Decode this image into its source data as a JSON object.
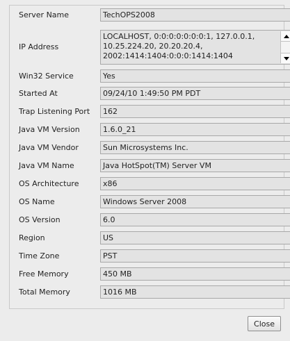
{
  "properties": [
    {
      "label": "Server Name",
      "value": "TechOPS2008"
    },
    {
      "label": "IP Address",
      "value": "LOCALHOST, 0:0:0:0:0:0:0:1, 127.0.0.1, 10.25.224.20, 20.20.20.4, 2002:1414:1404:0:0:0:1414:1404"
    },
    {
      "label": "Win32 Service",
      "value": "Yes"
    },
    {
      "label": "Started At",
      "value": "09/24/10 1:49:50 PM PDT"
    },
    {
      "label": "Trap Listening Port",
      "value": "162"
    },
    {
      "label": "Java VM Version",
      "value": "1.6.0_21"
    },
    {
      "label": "Java VM Vendor",
      "value": "Sun Microsystems Inc."
    },
    {
      "label": "Java VM Name",
      "value": "Java HotSpot(TM) Server VM"
    },
    {
      "label": "OS Architecture",
      "value": "x86"
    },
    {
      "label": "OS Name",
      "value": "Windows Server 2008"
    },
    {
      "label": "OS Version",
      "value": "6.0"
    },
    {
      "label": "Region",
      "value": "US"
    },
    {
      "label": "Time Zone",
      "value": "PST"
    },
    {
      "label": "Free Memory",
      "value": "450 MB"
    },
    {
      "label": "Total Memory",
      "value": "1016 MB"
    }
  ],
  "buttons": {
    "close_label": "Close"
  },
  "icons": {
    "scroll_up": "arrow-up-icon",
    "scroll_down": "arrow-down-icon"
  }
}
